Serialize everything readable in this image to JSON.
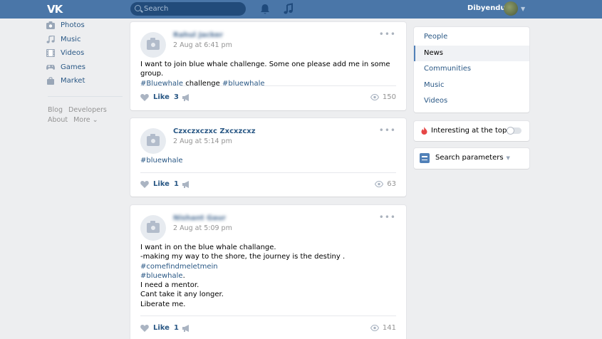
{
  "header": {
    "logo": "VK",
    "search_placeholder": "Search",
    "username": "Dibyendu"
  },
  "left_nav": {
    "items": [
      {
        "label": "Photos",
        "icon": "camera-icon"
      },
      {
        "label": "Music",
        "icon": "music-icon"
      },
      {
        "label": "Videos",
        "icon": "film-icon"
      },
      {
        "label": "Games",
        "icon": "gamepad-icon"
      },
      {
        "label": "Market",
        "icon": "bag-icon"
      }
    ],
    "footer": {
      "blog": "Blog",
      "developers": "Developers",
      "about": "About",
      "more": "More ⌄"
    }
  },
  "posts": [
    {
      "author": "Rahul Jacker",
      "date": "2 Aug at 6:41 pm",
      "text_lines": [
        {
          "plain": "I want to join blue whale challenge. Some one please add me in some group."
        }
      ],
      "tags_line": {
        "tag1": "#Bluewhale",
        "mid": " challenge ",
        "tag2": "#bluewhale"
      },
      "like_label": "Like",
      "like_count": "3",
      "views": "150"
    },
    {
      "author": "Czxczxczxc Zxcxzcxz",
      "date": "2 Aug at 5:14 pm",
      "tag": "#bluewhale",
      "like_label": "Like",
      "like_count": "1",
      "views": "63"
    },
    {
      "author": "Nishant Gaur",
      "date": "2 Aug at 5:09 pm",
      "line1": "I want in on the blue whale challange.",
      "line2": "-making my way to the shore, the journey is the destiny .",
      "tag1": "#comefindmeletmein",
      "tag2": "#bluewhale",
      "tag2_suffix": ".",
      "line5": "I need a mentor.",
      "line6": "Cant take it any longer.",
      "line7": "Liberate me.",
      "like_label": "Like",
      "like_count": "1",
      "views": "141"
    }
  ],
  "right_nav": {
    "items": [
      "People",
      "News",
      "Communities",
      "Music",
      "Videos"
    ],
    "active": "News"
  },
  "interesting": {
    "label": "Interesting at the top",
    "enabled": false
  },
  "search_params": {
    "label": "Search parameters"
  },
  "colors": {
    "header": "#4a76a8",
    "link": "#2a5885",
    "background": "#edeef0"
  }
}
